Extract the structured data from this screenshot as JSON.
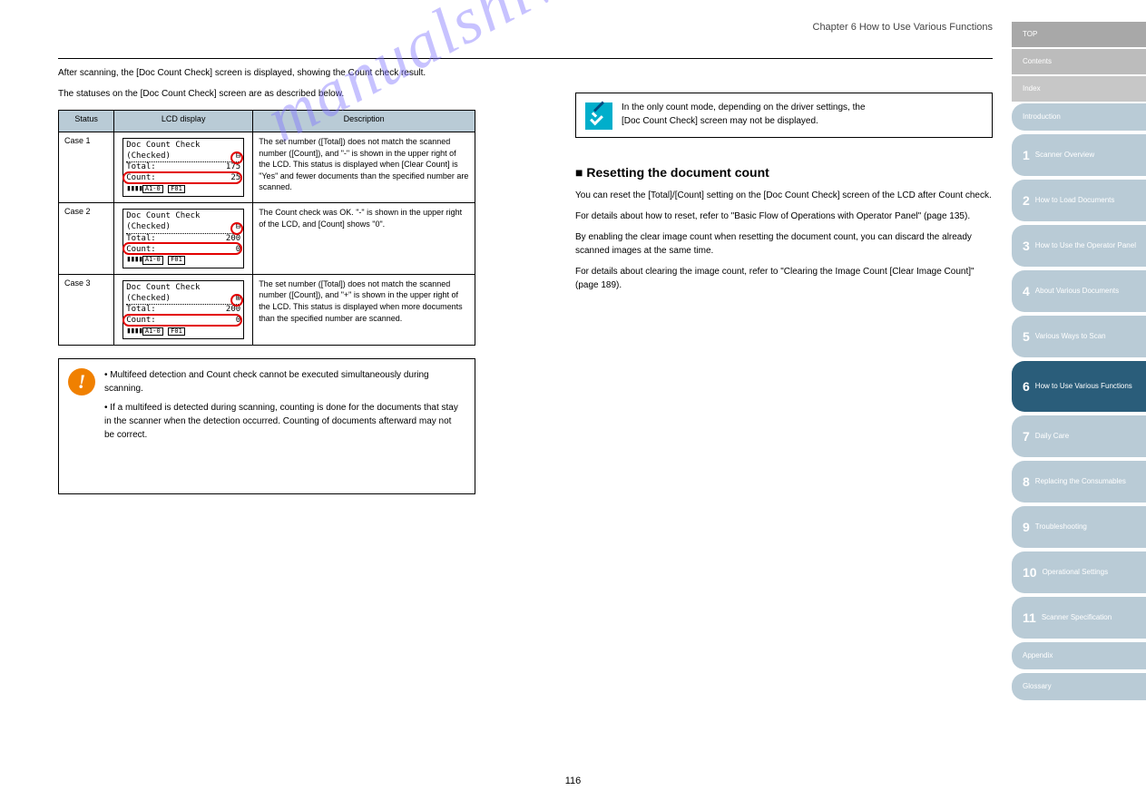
{
  "header": "Chapter 6 How to Use Various Functions",
  "col_left": {
    "intro1": "After scanning, the [Doc Count Check] screen is displayed, showing the Count check result.",
    "intro2": "The statuses on the [Doc Count Check] screen are as described below.",
    "table": {
      "col1": "Status",
      "col2": "LCD display",
      "col3": "Description",
      "rows": [
        {
          "status": "Case 1",
          "lcd_title": "Doc Count Check",
          "lcd_sub": "(Checked)",
          "lcd_total_l": "Total:",
          "lcd_total_v": "175",
          "lcd_count_l": "Count:",
          "lcd_count_v": "25",
          "lcd_icon1": "A1-0",
          "lcd_icon2": "F01",
          "sign": "minus",
          "desc": "The set number ([Total]) does not match the scanned number ([Count]), and \"-\" is shown in the upper right of the LCD. This status is displayed when [Clear Count] is \"Yes\" and fewer documents than the specified number are scanned."
        },
        {
          "status": "Case 2",
          "lcd_title": "Doc Count Check",
          "lcd_sub": "(Checked)",
          "lcd_total_l": "Total:",
          "lcd_total_v": "200",
          "lcd_count_l": "Count:",
          "lcd_count_v": "0",
          "lcd_icon1": "A1-0",
          "lcd_icon2": "F01",
          "sign": "minus",
          "desc": "The Count check was OK. \"-\" is shown in the upper right of the LCD, and [Count] shows \"0\"."
        },
        {
          "status": "Case 3",
          "lcd_title": "Doc Count Check",
          "lcd_sub": "(Checked)",
          "lcd_total_l": "Total:",
          "lcd_total_v": "200",
          "lcd_count_l": "Count:",
          "lcd_count_v": "0",
          "lcd_icon1": "A1-0",
          "lcd_icon2": "F01",
          "sign": "plus",
          "desc": "The set number ([Total]) does not match the scanned number ([Count]), and \"+\" is shown in the upper right of the LCD. This status is displayed when more documents than the specified number are scanned."
        }
      ]
    },
    "hint": {
      "bullets": [
        "Multifeed detection and Count check cannot be executed simultaneously during scanning.",
        "If a multifeed is detected during scanning, counting is done for the documents that stay in the scanner when the detection occurred. Counting of documents afterward may not be correct."
      ]
    }
  },
  "col_right": {
    "note_lines": [
      "In the only count mode, depending on the driver settings, the",
      "[Doc Count Check] screen may not be displayed."
    ],
    "subtitle": "■ Resetting the document count",
    "paras": [
      "You can reset the [Total]/[Count] setting on the [Doc Count Check] screen of the LCD after Count check.",
      "For details about how to reset, refer to \"Basic Flow of Operations with Operator Panel\" (page 135).",
      "By enabling the clear image count when resetting the document count, you can discard the already scanned images at the same time.",
      "For details about clearing the image count, refer to \"Clearing the Image Count [Clear Image Count]\" (page 189)."
    ]
  },
  "side_tabs": [
    {
      "type": "grey",
      "label": "TOP"
    },
    {
      "type": "grey2",
      "label": "Contents"
    },
    {
      "type": "grey3",
      "label": "Index"
    },
    {
      "type": "blue",
      "num": "",
      "label": "Introduction"
    },
    {
      "type": "blue",
      "num": "1",
      "label": "Scanner Overview"
    },
    {
      "type": "blue",
      "num": "2",
      "label": "How to Load Documents"
    },
    {
      "type": "blue",
      "num": "3",
      "label": "How to Use the Operator Panel"
    },
    {
      "type": "blue",
      "num": "4",
      "label": "About Various Documents"
    },
    {
      "type": "blue",
      "num": "5",
      "label": "Various Ways to Scan"
    },
    {
      "type": "active",
      "num": "6",
      "label": "How to Use Various Functions"
    },
    {
      "type": "blue",
      "num": "7",
      "label": "Daily Care"
    },
    {
      "type": "blue",
      "num": "8",
      "label": "Replacing the Consumables"
    },
    {
      "type": "blue",
      "num": "9",
      "label": "Troubleshooting"
    },
    {
      "type": "blue",
      "num": "10",
      "label": "Operational Settings"
    },
    {
      "type": "blue",
      "num": "11",
      "label": "Scanner Specification"
    },
    {
      "type": "blue",
      "num": "",
      "label": "Appendix"
    },
    {
      "type": "blue",
      "num": "",
      "label": "Glossary"
    }
  ],
  "page_number": "116",
  "watermark": "manualshive.com"
}
